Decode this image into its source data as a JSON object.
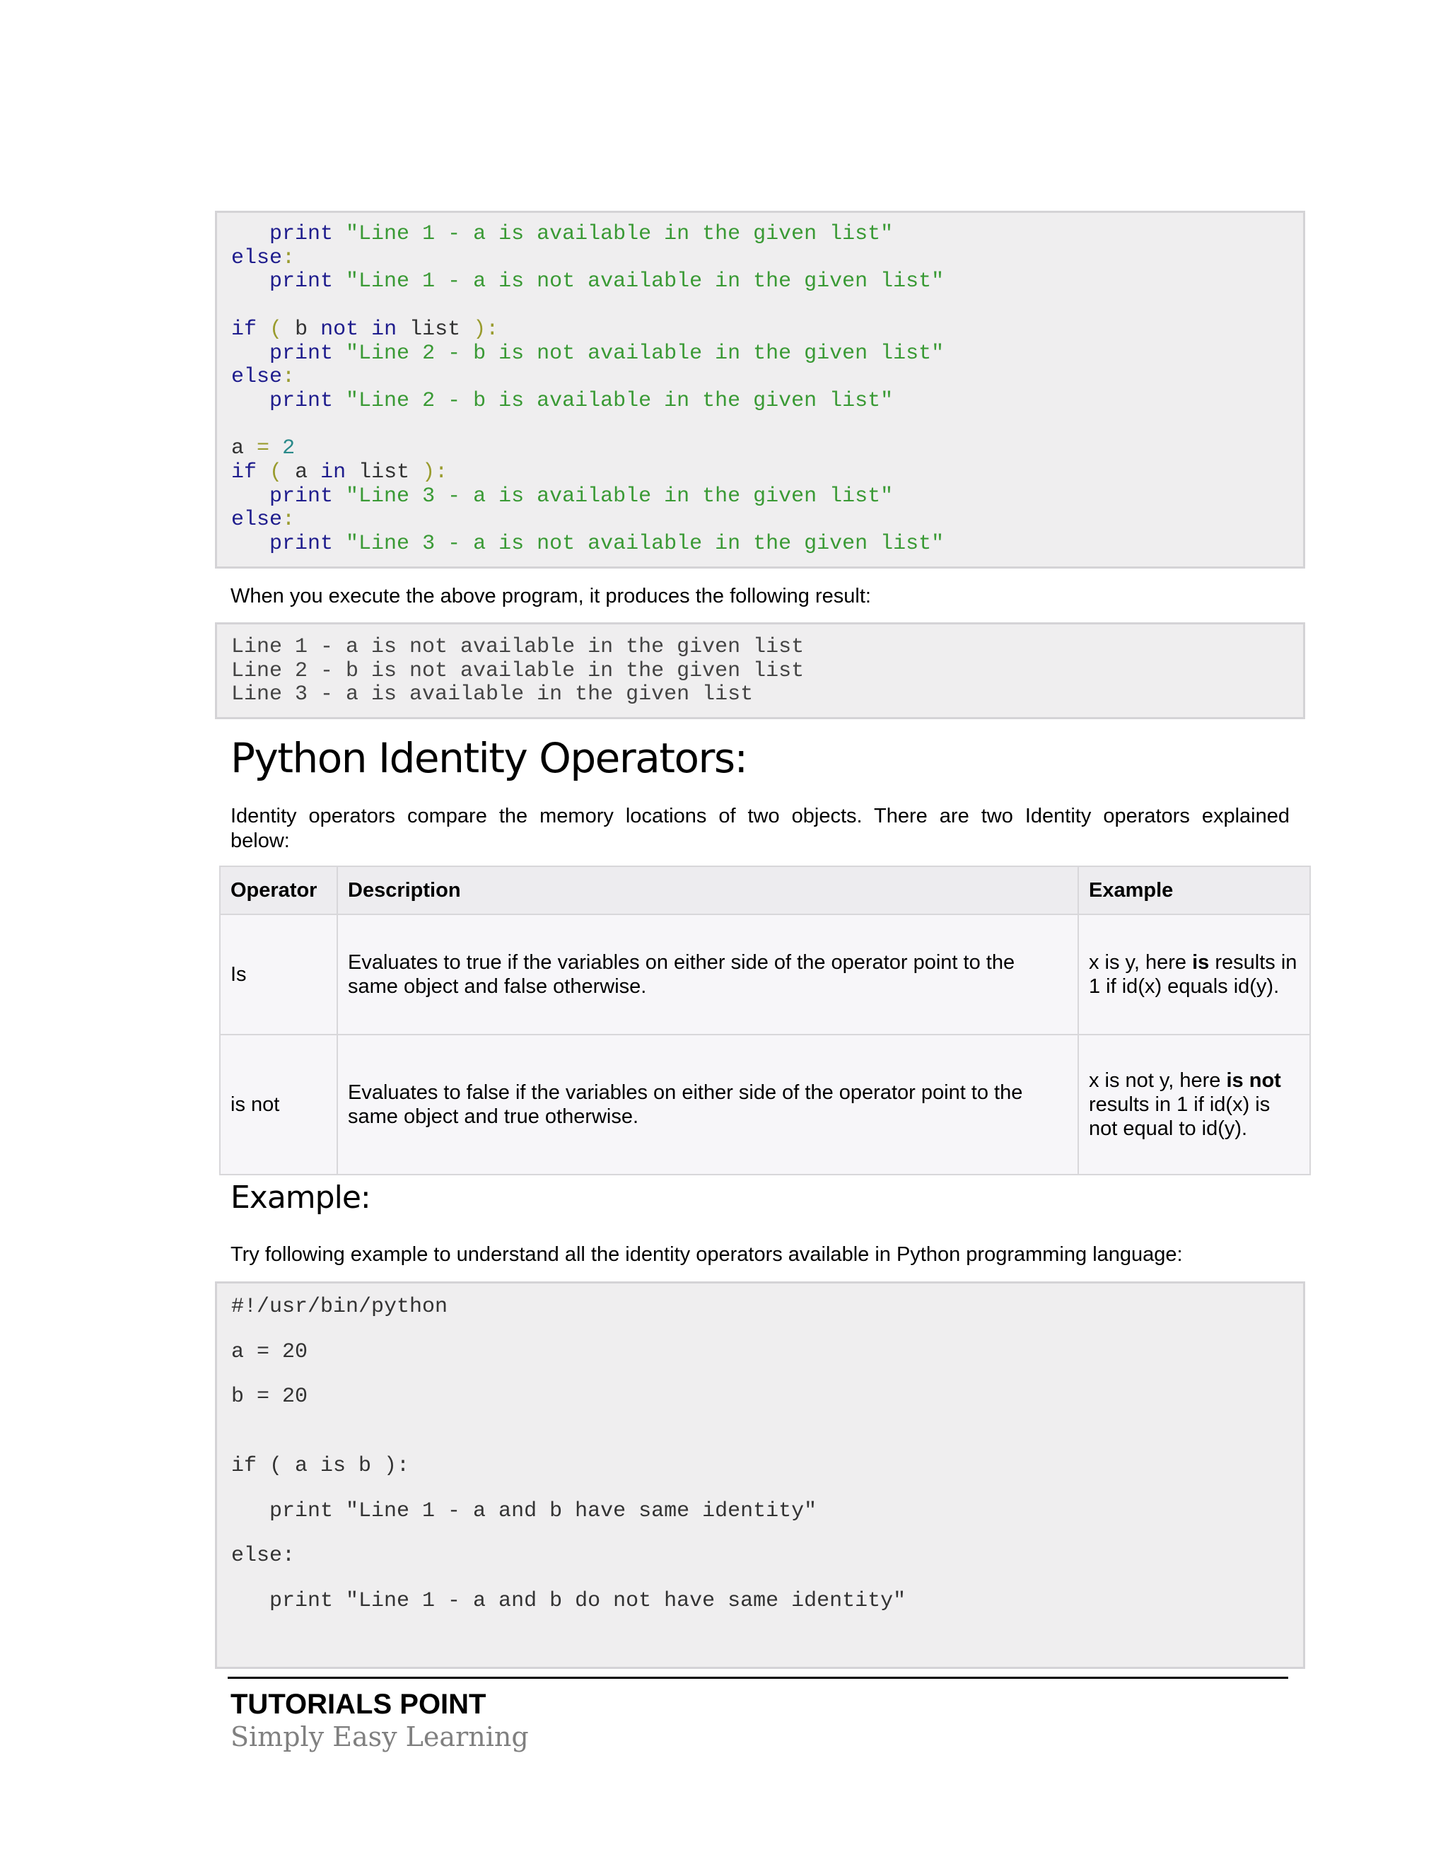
{
  "code_block_1": {
    "lines": [
      "   print \"Line 1 - a is available in the given list\"",
      "else:",
      "   print \"Line 1 - a is not available in the given list\"",
      "",
      "if ( b not in list ):",
      "   print \"Line 2 - b is not available in the given list\"",
      "else:",
      "   print \"Line 2 - b is available in the given list\"",
      "",
      "a = 2",
      "if ( a in list ):",
      "   print \"Line 3 - a is available in the given list\"",
      "else:",
      "   print \"Line 3 - a is not available in the given list\""
    ]
  },
  "para_result": "When you execute the above program, it produces the following result:",
  "output_block": {
    "lines": [
      "Line 1 - a is not available in the given list",
      "Line 2 - b is not available in the given list",
      "Line 3 - a is available in the given list"
    ]
  },
  "section_title": "Python Identity Operators:",
  "section_intro_line1": "Identity operators compare the memory locations of two objects. There are two Identity operators explained",
  "section_intro_line2": "below:",
  "table": {
    "headers": [
      "Operator",
      "Description",
      "Example"
    ],
    "rows": [
      {
        "operator": "Is",
        "description": "Evaluates to true if the variables on either side of the operator point to the same object and false otherwise.",
        "example_pre": "x is y, here ",
        "example_bold": "is",
        "example_post": " results in 1 if id(x) equals id(y)."
      },
      {
        "operator": "is not",
        "description": "Evaluates to false if the variables on either side of the operator point to the same object and true otherwise.",
        "example_pre": "x is not y, here ",
        "example_bold": "is not",
        "example_post": " results in 1 if id(x) is not equal to id(y)."
      }
    ]
  },
  "example_title": "Example:",
  "example_intro": "Try following example to understand all the identity operators available in Python programming language:",
  "code_block_3": {
    "lines": [
      "#!/usr/bin/python",
      "a = 20",
      "b = 20",
      "if ( a is b ):",
      "   print \"Line 1 - a and b have same identity\"",
      "else:",
      "   print \"Line 1 - a and b do not have same identity\""
    ]
  },
  "footer": {
    "brand": "TUTORIALS POINT",
    "tagline": "Simply Easy Learning"
  }
}
